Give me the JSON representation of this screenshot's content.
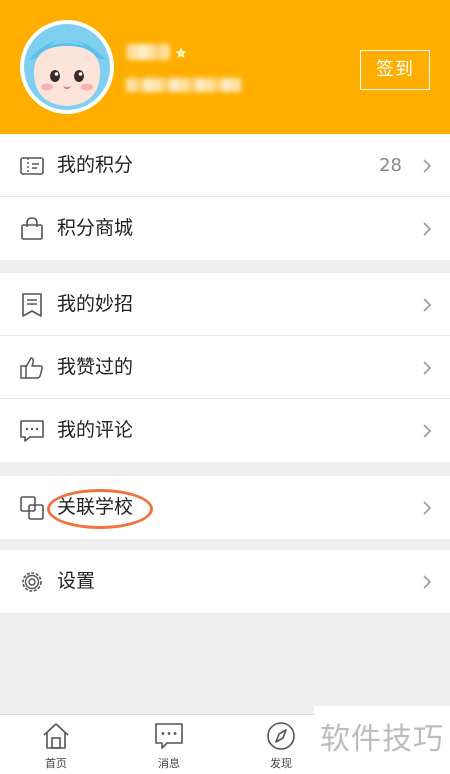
{
  "header": {
    "checkin_label": "签到"
  },
  "groups": [
    {
      "items": [
        {
          "label": "我的积分",
          "count": "28",
          "icon": "ticket-icon"
        },
        {
          "label": "积分商城",
          "icon": "shopping-bag-icon"
        }
      ]
    },
    {
      "items": [
        {
          "label": "我的妙招",
          "icon": "bookmark-list-icon"
        },
        {
          "label": "我赞过的",
          "icon": "thumbs-up-icon"
        },
        {
          "label": "我的评论",
          "icon": "comment-icon"
        }
      ]
    },
    {
      "items": [
        {
          "label": "关联学校",
          "icon": "link-squares-icon"
        }
      ]
    },
    {
      "items": [
        {
          "label": "设置",
          "icon": "gear-icon"
        }
      ]
    }
  ],
  "tabbar": [
    {
      "label": "首页",
      "icon": "home-icon"
    },
    {
      "label": "消息",
      "icon": "message-icon"
    },
    {
      "label": "发现",
      "icon": "compass-icon"
    }
  ],
  "watermark": "软件技巧",
  "colors": {
    "header_bg": "#ffae00",
    "highlight_circle": "#f0733f"
  }
}
